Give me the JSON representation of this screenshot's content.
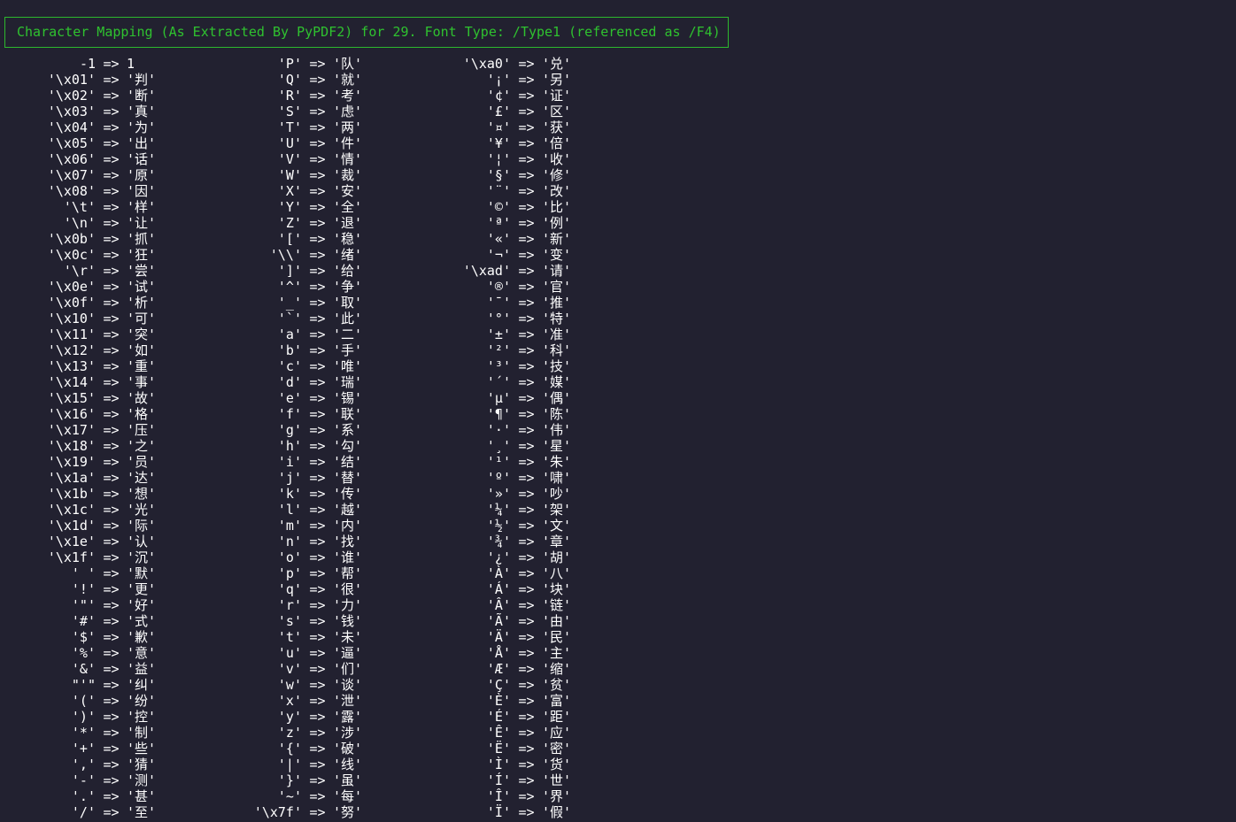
{
  "header": {
    "title": "Character Mapping (As Extracted By PyPDF2) for 29. Font Type: /Type1 (referenced as /F4)"
  },
  "columns": [
    [
      [
        "-1",
        "1"
      ],
      [
        "'\\x01'",
        "'判'"
      ],
      [
        "'\\x02'",
        "'断'"
      ],
      [
        "'\\x03'",
        "'真'"
      ],
      [
        "'\\x04'",
        "'为'"
      ],
      [
        "'\\x05'",
        "'出'"
      ],
      [
        "'\\x06'",
        "'话'"
      ],
      [
        "'\\x07'",
        "'原'"
      ],
      [
        "'\\x08'",
        "'因'"
      ],
      [
        "'\\t'",
        "'样'"
      ],
      [
        "'\\n'",
        "'让'"
      ],
      [
        "'\\x0b'",
        "'抓'"
      ],
      [
        "'\\x0c'",
        "'狂'"
      ],
      [
        "'\\r'",
        "'尝'"
      ],
      [
        "'\\x0e'",
        "'试'"
      ],
      [
        "'\\x0f'",
        "'析'"
      ],
      [
        "'\\x10'",
        "'可'"
      ],
      [
        "'\\x11'",
        "'突'"
      ],
      [
        "'\\x12'",
        "'如'"
      ],
      [
        "'\\x13'",
        "'重'"
      ],
      [
        "'\\x14'",
        "'事'"
      ],
      [
        "'\\x15'",
        "'故'"
      ],
      [
        "'\\x16'",
        "'格'"
      ],
      [
        "'\\x17'",
        "'压'"
      ],
      [
        "'\\x18'",
        "'之'"
      ],
      [
        "'\\x19'",
        "'员'"
      ],
      [
        "'\\x1a'",
        "'达'"
      ],
      [
        "'\\x1b'",
        "'想'"
      ],
      [
        "'\\x1c'",
        "'光'"
      ],
      [
        "'\\x1d'",
        "'际'"
      ],
      [
        "'\\x1e'",
        "'认'"
      ],
      [
        "'\\x1f'",
        "'沉'"
      ],
      [
        "' '",
        "'默'"
      ],
      [
        "'!'",
        "'更'"
      ],
      [
        "'\"'",
        "'好'"
      ],
      [
        "'#'",
        "'式'"
      ],
      [
        "'$'",
        "'歉'"
      ],
      [
        "'%'",
        "'意'"
      ],
      [
        "'&'",
        "'益'"
      ],
      [
        "\"'\"",
        "'纠'"
      ],
      [
        "'('",
        "'纷'"
      ],
      [
        "')'",
        "'控'"
      ],
      [
        "'*'",
        "'制'"
      ],
      [
        "'+'",
        "'些'"
      ],
      [
        "','",
        "'猜'"
      ],
      [
        "'-'",
        "'测'"
      ],
      [
        "'.'",
        "'甚'"
      ],
      [
        "'/'",
        "'至'"
      ]
    ],
    [
      [
        "'P'",
        "'队'"
      ],
      [
        "'Q'",
        "'就'"
      ],
      [
        "'R'",
        "'考'"
      ],
      [
        "'S'",
        "'虑'"
      ],
      [
        "'T'",
        "'两'"
      ],
      [
        "'U'",
        "'件'"
      ],
      [
        "'V'",
        "'情'"
      ],
      [
        "'W'",
        "'裁'"
      ],
      [
        "'X'",
        "'安'"
      ],
      [
        "'Y'",
        "'全'"
      ],
      [
        "'Z'",
        "'退'"
      ],
      [
        "'['",
        "'稳'"
      ],
      [
        "'\\\\'",
        "'绪'"
      ],
      [
        "']'",
        "'给'"
      ],
      [
        "'^'",
        "'争'"
      ],
      [
        "'_'",
        "'取'"
      ],
      [
        "'`'",
        "'此'"
      ],
      [
        "'a'",
        "'二'"
      ],
      [
        "'b'",
        "'手'"
      ],
      [
        "'c'",
        "'唯'"
      ],
      [
        "'d'",
        "'瑞'"
      ],
      [
        "'e'",
        "'锡'"
      ],
      [
        "'f'",
        "'联'"
      ],
      [
        "'g'",
        "'系'"
      ],
      [
        "'h'",
        "'勾'"
      ],
      [
        "'i'",
        "'结'"
      ],
      [
        "'j'",
        "'替'"
      ],
      [
        "'k'",
        "'传'"
      ],
      [
        "'l'",
        "'越'"
      ],
      [
        "'m'",
        "'内'"
      ],
      [
        "'n'",
        "'找'"
      ],
      [
        "'o'",
        "'谁'"
      ],
      [
        "'p'",
        "'帮'"
      ],
      [
        "'q'",
        "'很'"
      ],
      [
        "'r'",
        "'力'"
      ],
      [
        "'s'",
        "'钱'"
      ],
      [
        "'t'",
        "'未'"
      ],
      [
        "'u'",
        "'逼'"
      ],
      [
        "'v'",
        "'们'"
      ],
      [
        "'w'",
        "'谈'"
      ],
      [
        "'x'",
        "'泄'"
      ],
      [
        "'y'",
        "'露'"
      ],
      [
        "'z'",
        "'涉'"
      ],
      [
        "'{'",
        "'破'"
      ],
      [
        "'|'",
        "'线'"
      ],
      [
        "'}'",
        "'虽'"
      ],
      [
        "'~'",
        "'每'"
      ],
      [
        "'\\x7f'",
        "'努'"
      ]
    ],
    [
      [
        "'\\xa0'",
        "'兑'"
      ],
      [
        "'¡'",
        "'另'"
      ],
      [
        "'¢'",
        "'证'"
      ],
      [
        "'£'",
        "'区'"
      ],
      [
        "'¤'",
        "'获'"
      ],
      [
        "'¥'",
        "'倍'"
      ],
      [
        "'¦'",
        "'收'"
      ],
      [
        "'§'",
        "'修'"
      ],
      [
        "'¨'",
        "'改'"
      ],
      [
        "'©'",
        "'比'"
      ],
      [
        "'ª'",
        "'例'"
      ],
      [
        "'«'",
        "'新'"
      ],
      [
        "'¬'",
        "'变'"
      ],
      [
        "'\\xad'",
        "'请'"
      ],
      [
        "'®'",
        "'官'"
      ],
      [
        "'¯'",
        "'推'"
      ],
      [
        "'°'",
        "'特'"
      ],
      [
        "'±'",
        "'准'"
      ],
      [
        "'²'",
        "'科'"
      ],
      [
        "'³'",
        "'技'"
      ],
      [
        "'´'",
        "'媒'"
      ],
      [
        "'µ'",
        "'偶'"
      ],
      [
        "'¶'",
        "'陈'"
      ],
      [
        "'·'",
        "'伟'"
      ],
      [
        "'¸'",
        "'星'"
      ],
      [
        "'¹'",
        "'朱'"
      ],
      [
        "'º'",
        "'啸'"
      ],
      [
        "'»'",
        "'吵'"
      ],
      [
        "'¼'",
        "'架'"
      ],
      [
        "'½'",
        "'文'"
      ],
      [
        "'¾'",
        "'章'"
      ],
      [
        "'¿'",
        "'胡'"
      ],
      [
        "'À'",
        "'八'"
      ],
      [
        "'Á'",
        "'块'"
      ],
      [
        "'Â'",
        "'链'"
      ],
      [
        "'Ã'",
        "'由'"
      ],
      [
        "'Ä'",
        "'民'"
      ],
      [
        "'Å'",
        "'主'"
      ],
      [
        "'Æ'",
        "'缩'"
      ],
      [
        "'Ç'",
        "'贫'"
      ],
      [
        "'È'",
        "'富'"
      ],
      [
        "'É'",
        "'距'"
      ],
      [
        "'Ê'",
        "'应'"
      ],
      [
        "'Ë'",
        "'密'"
      ],
      [
        "'Ì'",
        "'货'"
      ],
      [
        "'Í'",
        "'世'"
      ],
      [
        "'Î'",
        "'界'"
      ],
      [
        "'Ï'",
        "'假'"
      ]
    ]
  ],
  "arrow": "=>",
  "colors": {
    "background": "#222130",
    "accent": "#2fc22f",
    "text": "#ffffff"
  }
}
